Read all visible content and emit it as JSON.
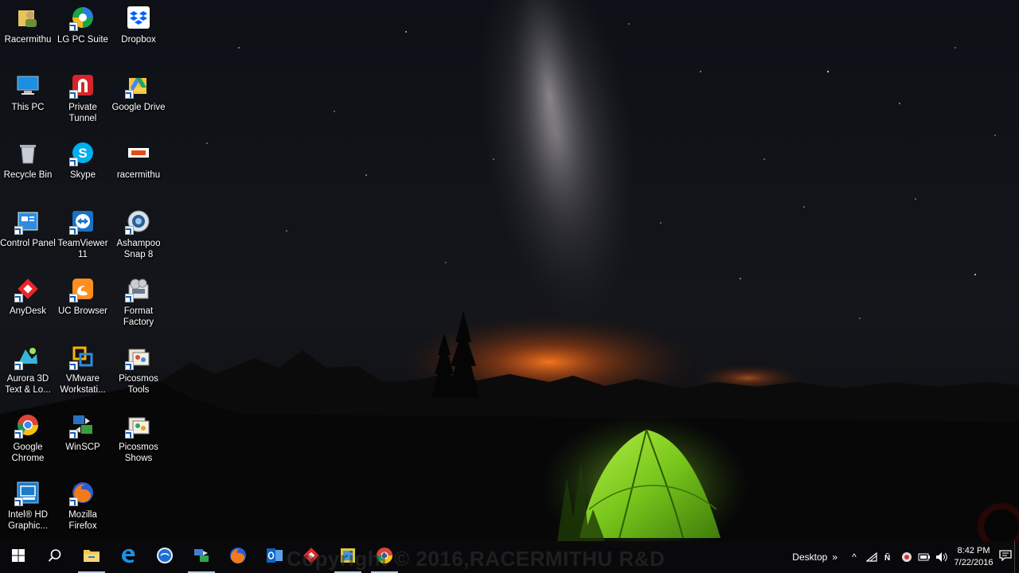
{
  "desktop": {
    "icons": [
      {
        "label": "Racermithu",
        "icon": "user-folder-icon"
      },
      {
        "label": "LG PC Suite",
        "icon": "lg-pc-suite-icon"
      },
      {
        "label": "Dropbox",
        "icon": "dropbox-icon"
      },
      {
        "label": "This PC",
        "icon": "this-pc-icon"
      },
      {
        "label": "Private Tunnel",
        "icon": "private-tunnel-icon"
      },
      {
        "label": "Google Drive",
        "icon": "google-drive-icon"
      },
      {
        "label": "Recycle Bin",
        "icon": "recycle-bin-icon"
      },
      {
        "label": "Skype",
        "icon": "skype-icon"
      },
      {
        "label": "racermithu",
        "icon": "racermithu-logo-icon"
      },
      {
        "label": "Control Panel",
        "icon": "control-panel-icon"
      },
      {
        "label": "TeamViewer 11",
        "icon": "teamviewer-icon"
      },
      {
        "label": "Ashampoo Snap 8",
        "icon": "ashampoo-snap-icon"
      },
      {
        "label": "AnyDesk",
        "icon": "anydesk-icon"
      },
      {
        "label": "UC Browser",
        "icon": "uc-browser-icon"
      },
      {
        "label": "Format Factory",
        "icon": "format-factory-icon"
      },
      {
        "label": "Aurora 3D Text & Lo...",
        "icon": "aurora-3d-icon"
      },
      {
        "label": "VMware Workstati...",
        "icon": "vmware-icon"
      },
      {
        "label": "Picosmos Tools",
        "icon": "picosmos-tools-icon"
      },
      {
        "label": "Google Chrome",
        "icon": "chrome-icon"
      },
      {
        "label": "WinSCP",
        "icon": "winscp-icon"
      },
      {
        "label": "Picosmos Shows",
        "icon": "picosmos-shows-icon"
      },
      {
        "label": "Intel® HD Graphic...",
        "icon": "intel-hd-graphics-icon"
      },
      {
        "label": "Mozilla Firefox",
        "icon": "firefox-icon"
      }
    ]
  },
  "taskbar": {
    "buttons": [
      {
        "icon": "windows-start-icon"
      },
      {
        "icon": "search-icon"
      },
      {
        "icon": "file-explorer-icon"
      },
      {
        "icon": "edge-icon"
      },
      {
        "icon": "skype-taskbar-icon"
      },
      {
        "icon": "network-tool-icon"
      },
      {
        "icon": "firefox-taskbar-icon"
      },
      {
        "icon": "outlook-icon"
      },
      {
        "icon": "anydesk-taskbar-icon"
      },
      {
        "icon": "sticky-app-icon"
      },
      {
        "icon": "chrome-taskbar-icon"
      }
    ],
    "watermark": "Copyright © 2016,RACERMITHU R&D",
    "tray": {
      "toolbar_label": "Desktop",
      "toolbar_chevron": "»",
      "show_hidden": "^",
      "time": "8:42 PM",
      "date": "7/22/2016"
    }
  },
  "colors": {
    "sky_top": "#0b0e14",
    "horizon_glow": "#e0621c",
    "tent": "#7fd321",
    "taskbar": "#0a0a0c"
  }
}
